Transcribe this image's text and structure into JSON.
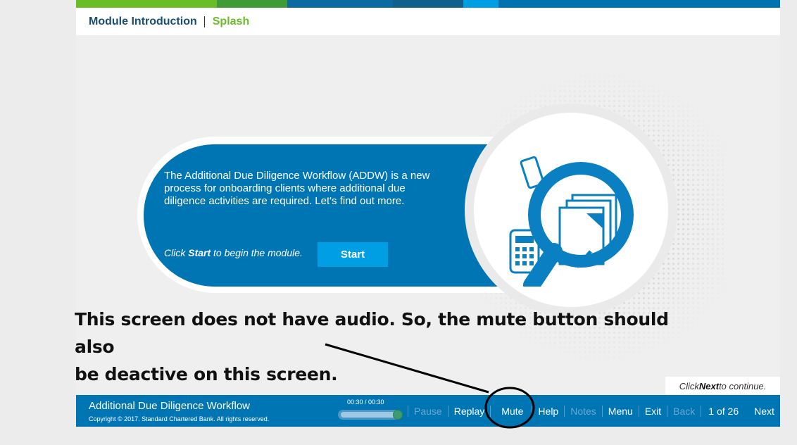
{
  "topbar_colors": [
    "#69be28",
    "#3e9b36",
    "#0b6aa0",
    "#105f8d",
    "#009fe3",
    "#0072b0"
  ],
  "header": {
    "breadcrumb_module": "Module Introduction",
    "breadcrumb_screen": "Splash"
  },
  "content": {
    "intro_text": "The Additional Due Diligence Workflow (ADDW) is a new process for onboarding clients where additional due diligence activities are required. Let's find out more.",
    "instruction_prefix": "Click ",
    "instruction_bold": "Start",
    "instruction_suffix": " to begin the module.",
    "start_label": "Start",
    "illustration_icon": "magnifier-documents-icon"
  },
  "annotation": {
    "line1": "This screen does not have audio. So, the mute button should also",
    "line2": "be deactive on this screen."
  },
  "continue_hint": {
    "prefix": "Click ",
    "bold": "Next",
    "suffix": " to continue."
  },
  "footer": {
    "course_title": "Additional Due Diligence Workflow",
    "copyright": "Copyright © 2017. Standard Chartered Bank. All rights reserved.",
    "timecode": "00:30 / 00:30",
    "progress": 1.0,
    "controls": {
      "pause": "Pause",
      "replay": "Replay",
      "mute": "Mute",
      "help": "Help",
      "notes": "Notes",
      "menu": "Menu",
      "exit": "Exit",
      "back": "Back",
      "next": "Next"
    },
    "page_count": "1 of 26"
  },
  "colors": {
    "brand_blue": "#0075b4",
    "accent_blue": "#009fe3",
    "brand_green": "#69be28",
    "dim_control": "#6ba7cf"
  }
}
